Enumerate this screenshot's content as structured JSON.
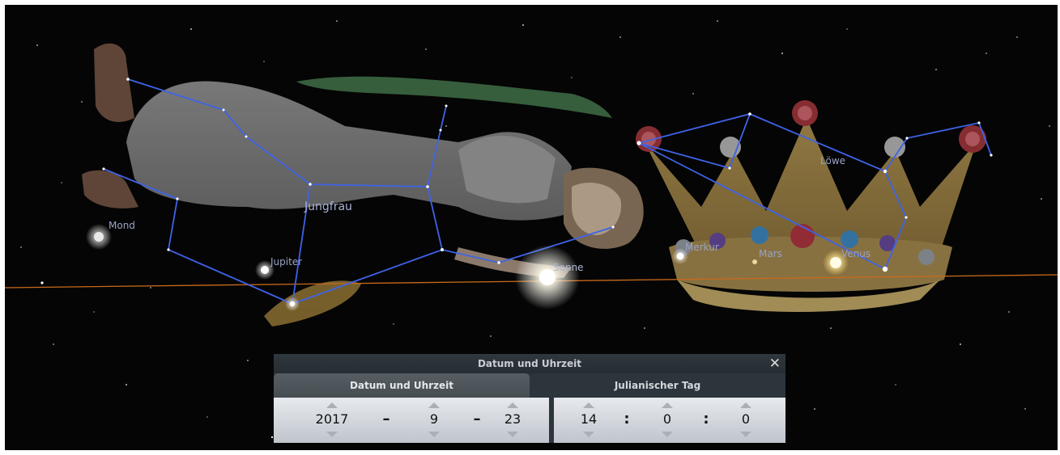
{
  "sky": {
    "constellations": {
      "virgo": "Jungfrau",
      "leo": "Löwe"
    },
    "objects": {
      "moon": "Mond",
      "jupiter": "Jupiter",
      "sun": "Sonne",
      "mercury": "Merkur",
      "mars": "Mars",
      "venus": "Venus"
    },
    "colors": {
      "sky_background": "#050505",
      "constellation_line": "#3e63e8",
      "ecliptic": "#c86a1a",
      "label": "#9aa3c4"
    }
  },
  "dialog": {
    "title": "Datum und Uhrzeit",
    "close_icon": "close-icon",
    "tabs": [
      {
        "label": "Datum und Uhrzeit",
        "active": true
      },
      {
        "label": "Julianischer Tag",
        "active": false
      }
    ],
    "date": {
      "year": "2017",
      "month": "9",
      "day": "23",
      "separator": "–"
    },
    "time": {
      "hour": "14",
      "minute": "0",
      "second": "0",
      "separator": ":"
    }
  }
}
